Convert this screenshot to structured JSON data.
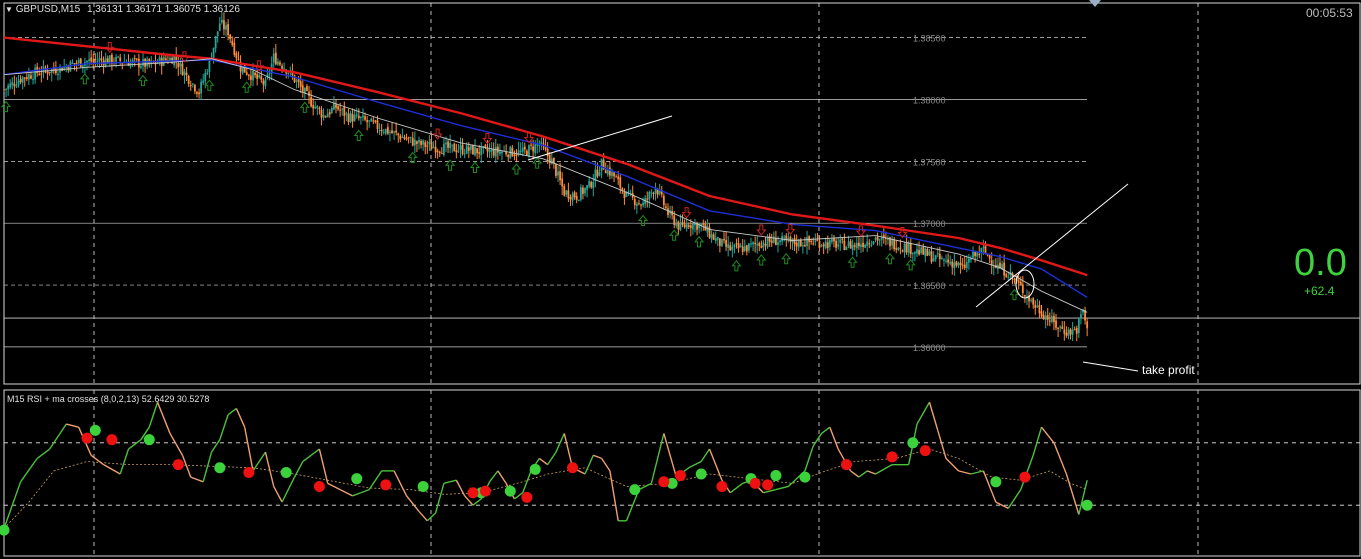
{
  "header": {
    "symbol_label": "GBPUSD,M15",
    "ohlc_text": "1.36131 1.36171 1.36075 1.36126",
    "clock": "00:05:53"
  },
  "overlay": {
    "big_value": "0.0",
    "delta_value": "+62.4",
    "take_profit_label": "take profit"
  },
  "indicator": {
    "label": "M15 RSI + ma crosses (8,0,2,13) 52.6429 30.5278"
  },
  "colors": {
    "background": "#000000",
    "grid": "#ffffff",
    "bull_candle": "#26a69a",
    "bear_candle": "#ff8c3a",
    "ma_slow": "#e01818",
    "ma_mid": "#1e2fd8",
    "ma_fast": "#c8c8c8",
    "arrow_up": "#1e8c1e",
    "arrow_down": "#d02020",
    "rsi_up": "#4cc23c",
    "rsi_down": "#f0a070",
    "cross_up": "#3cd23c",
    "cross_down": "#ee1111"
  },
  "chart_data": [
    {
      "type": "candlestick",
      "title": "GBPUSD,M15",
      "ylabel": "",
      "ylim": [
        1.357,
        1.3878
      ],
      "y_ticks": [
        "1.38500",
        "1.38000",
        "1.37500",
        "1.37000",
        "1.36500",
        "1.36000"
      ],
      "y_tick_values": [
        1.385,
        1.38,
        1.375,
        1.37,
        1.365,
        1.36
      ],
      "last_close": 1.36126,
      "take_profit_level": 1.3612,
      "close_path": [
        [
          0,
          1.3808
        ],
        [
          8,
          1.3817
        ],
        [
          16,
          1.3822
        ],
        [
          26,
          1.3825
        ],
        [
          36,
          1.383
        ],
        [
          46,
          1.3832
        ],
        [
          58,
          1.3831
        ],
        [
          70,
          1.3828
        ],
        [
          82,
          1.3834
        ],
        [
          88,
          1.3819
        ],
        [
          94,
          1.3806
        ],
        [
          99,
          1.383
        ],
        [
          104,
          1.3862
        ],
        [
          108,
          1.3855
        ],
        [
          114,
          1.3826
        ],
        [
          120,
          1.3819
        ],
        [
          126,
          1.3812
        ],
        [
          130,
          1.3834
        ],
        [
          136,
          1.3825
        ],
        [
          142,
          1.3812
        ],
        [
          148,
          1.3798
        ],
        [
          154,
          1.3787
        ],
        [
          160,
          1.3794
        ],
        [
          166,
          1.3786
        ],
        [
          172,
          1.3784
        ],
        [
          180,
          1.3778
        ],
        [
          190,
          1.3771
        ],
        [
          200,
          1.3764
        ],
        [
          210,
          1.3761
        ],
        [
          220,
          1.376
        ],
        [
          230,
          1.3758
        ],
        [
          240,
          1.3758
        ],
        [
          250,
          1.3757
        ],
        [
          258,
          1.3764
        ],
        [
          264,
          1.375
        ],
        [
          270,
          1.3725
        ],
        [
          276,
          1.3722
        ],
        [
          282,
          1.373
        ],
        [
          288,
          1.3748
        ],
        [
          294,
          1.3738
        ],
        [
          300,
          1.3722
        ],
        [
          308,
          1.3715
        ],
        [
          314,
          1.373
        ],
        [
          320,
          1.3708
        ],
        [
          326,
          1.3696
        ],
        [
          330,
          1.37
        ],
        [
          336,
          1.3698
        ],
        [
          344,
          1.3685
        ],
        [
          350,
          1.3679
        ],
        [
          358,
          1.368
        ],
        [
          364,
          1.3684
        ],
        [
          372,
          1.3686
        ],
        [
          380,
          1.3684
        ],
        [
          390,
          1.3685
        ],
        [
          400,
          1.3683
        ],
        [
          410,
          1.3682
        ],
        [
          420,
          1.3688
        ],
        [
          428,
          1.3684
        ],
        [
          436,
          1.368
        ],
        [
          444,
          1.3675
        ],
        [
          452,
          1.367
        ],
        [
          458,
          1.3668
        ],
        [
          462,
          1.3663
        ],
        [
          466,
          1.3672
        ],
        [
          472,
          1.3678
        ],
        [
          478,
          1.3666
        ],
        [
          484,
          1.366
        ],
        [
          490,
          1.3648
        ],
        [
          496,
          1.3635
        ],
        [
          502,
          1.3625
        ],
        [
          508,
          1.3616
        ],
        [
          513,
          1.3612
        ],
        [
          517,
          1.3614
        ],
        [
          520,
          1.363
        ],
        [
          522,
          1.36126
        ]
      ],
      "moving_averages": [
        {
          "name": "",
          "color": "#e01818",
          "values": [
            [
              0,
              1.385
            ],
            [
              40,
              1.3843
            ],
            [
              80,
              1.3836
            ],
            [
              100,
              1.3833
            ],
            [
              140,
              1.3822
            ],
            [
              180,
              1.3806
            ],
            [
              220,
              1.3789
            ],
            [
              260,
              1.377
            ],
            [
              300,
              1.3748
            ],
            [
              340,
              1.3722
            ],
            [
              380,
              1.3707
            ],
            [
              420,
              1.3698
            ],
            [
              460,
              1.3688
            ],
            [
              480,
              1.368
            ],
            [
              500,
              1.367
            ],
            [
              522,
              1.3658
            ]
          ]
        },
        {
          "name": "",
          "color": "#1e2fd8",
          "values": [
            [
              0,
              1.382
            ],
            [
              40,
              1.3829
            ],
            [
              80,
              1.3831
            ],
            [
              100,
              1.3832
            ],
            [
              140,
              1.3818
            ],
            [
              180,
              1.3798
            ],
            [
              220,
              1.3779
            ],
            [
              260,
              1.3763
            ],
            [
              300,
              1.3738
            ],
            [
              340,
              1.371
            ],
            [
              380,
              1.3699
            ],
            [
              420,
              1.3694
            ],
            [
              460,
              1.368
            ],
            [
              480,
              1.3673
            ],
            [
              500,
              1.3663
            ],
            [
              522,
              1.364
            ]
          ]
        },
        {
          "name": "",
          "color": "#c8c8c8",
          "values": [
            [
              0,
              1.382
            ],
            [
              40,
              1.3826
            ],
            [
              80,
              1.383
            ],
            [
              100,
              1.3833
            ],
            [
              120,
              1.3824
            ],
            [
              140,
              1.3808
            ],
            [
              180,
              1.3785
            ],
            [
              220,
              1.3765
            ],
            [
              260,
              1.3752
            ],
            [
              300,
              1.3725
            ],
            [
              340,
              1.3695
            ],
            [
              380,
              1.3686
            ],
            [
              420,
              1.369
            ],
            [
              460,
              1.3675
            ],
            [
              480,
              1.3664
            ],
            [
              500,
              1.3645
            ],
            [
              522,
              1.3628
            ]
          ]
        }
      ],
      "signal_up_arrows": [
        0,
        38,
        66,
        98,
        116,
        144,
        170,
        196,
        214,
        226,
        246,
        256,
        307,
        322,
        334,
        352,
        364,
        376,
        408,
        426,
        436,
        486
      ],
      "signal_down_arrows": [
        50,
        86,
        122,
        208,
        232,
        252,
        328,
        364,
        378,
        412,
        432
      ]
    },
    {
      "type": "line",
      "title": "M15 RSI + ma crosses (8,0,2,13) 52.6429 30.5278",
      "ylim": [
        0,
        100
      ],
      "rsi": [
        [
          0,
          15
        ],
        [
          8,
          45
        ],
        [
          16,
          60
        ],
        [
          22,
          66
        ],
        [
          30,
          82
        ],
        [
          36,
          80
        ],
        [
          42,
          62
        ],
        [
          48,
          56
        ],
        [
          56,
          50
        ],
        [
          60,
          66
        ],
        [
          66,
          72
        ],
        [
          70,
          80
        ],
        [
          74,
          96
        ],
        [
          80,
          76
        ],
        [
          86,
          62
        ],
        [
          90,
          48
        ],
        [
          96,
          45
        ],
        [
          100,
          64
        ],
        [
          104,
          72
        ],
        [
          108,
          88
        ],
        [
          112,
          92
        ],
        [
          116,
          80
        ],
        [
          120,
          52
        ],
        [
          126,
          64
        ],
        [
          130,
          42
        ],
        [
          134,
          32
        ],
        [
          140,
          48
        ],
        [
          144,
          58
        ],
        [
          148,
          62
        ],
        [
          152,
          66
        ],
        [
          156,
          44
        ],
        [
          162,
          40
        ],
        [
          168,
          36
        ],
        [
          172,
          38
        ],
        [
          176,
          40
        ],
        [
          182,
          52
        ],
        [
          188,
          52
        ],
        [
          194,
          36
        ],
        [
          200,
          26
        ],
        [
          204,
          20
        ],
        [
          208,
          25
        ],
        [
          212,
          44
        ],
        [
          218,
          46
        ],
        [
          222,
          36
        ],
        [
          226,
          30
        ],
        [
          230,
          34
        ],
        [
          234,
          45
        ],
        [
          238,
          52
        ],
        [
          242,
          44
        ],
        [
          246,
          34
        ],
        [
          250,
          38
        ],
        [
          254,
          52
        ],
        [
          258,
          60
        ],
        [
          262,
          56
        ],
        [
          266,
          64
        ],
        [
          270,
          76
        ],
        [
          274,
          54
        ],
        [
          280,
          50
        ],
        [
          284,
          62
        ],
        [
          288,
          60
        ],
        [
          292,
          52
        ],
        [
          296,
          20
        ],
        [
          300,
          20
        ],
        [
          306,
          40
        ],
        [
          312,
          44
        ],
        [
          318,
          76
        ],
        [
          324,
          48
        ],
        [
          330,
          54
        ],
        [
          336,
          58
        ],
        [
          340,
          66
        ],
        [
          346,
          46
        ],
        [
          350,
          38
        ],
        [
          356,
          44
        ],
        [
          360,
          46
        ],
        [
          366,
          38
        ],
        [
          372,
          40
        ],
        [
          378,
          42
        ],
        [
          386,
          52
        ],
        [
          390,
          68
        ],
        [
          394,
          76
        ],
        [
          398,
          80
        ],
        [
          402,
          66
        ],
        [
          408,
          52
        ],
        [
          412,
          48
        ],
        [
          416,
          52
        ],
        [
          420,
          50
        ],
        [
          428,
          56
        ],
        [
          436,
          56
        ],
        [
          440,
          82
        ],
        [
          446,
          96
        ],
        [
          450,
          78
        ],
        [
          454,
          60
        ],
        [
          460,
          52
        ],
        [
          466,
          50
        ],
        [
          472,
          52
        ],
        [
          478,
          32
        ],
        [
          484,
          28
        ],
        [
          490,
          40
        ],
        [
          496,
          62
        ],
        [
          500,
          80
        ],
        [
          506,
          70
        ],
        [
          512,
          50
        ],
        [
          518,
          24
        ],
        [
          522,
          46
        ]
      ],
      "signal": [
        [
          0,
          15
        ],
        [
          12,
          32
        ],
        [
          24,
          52
        ],
        [
          40,
          58
        ],
        [
          60,
          56
        ],
        [
          80,
          56
        ],
        [
          100,
          55
        ],
        [
          120,
          54
        ],
        [
          140,
          50
        ],
        [
          160,
          45
        ],
        [
          176,
          41
        ],
        [
          196,
          40
        ],
        [
          212,
          37
        ],
        [
          230,
          38
        ],
        [
          250,
          45
        ],
        [
          262,
          50
        ],
        [
          280,
          54
        ],
        [
          300,
          42
        ],
        [
          320,
          44
        ],
        [
          340,
          50
        ],
        [
          360,
          47
        ],
        [
          380,
          44
        ],
        [
          396,
          52
        ],
        [
          410,
          58
        ],
        [
          430,
          60
        ],
        [
          446,
          66
        ],
        [
          460,
          60
        ],
        [
          476,
          48
        ],
        [
          490,
          46
        ],
        [
          504,
          52
        ],
        [
          514,
          44
        ],
        [
          522,
          40
        ]
      ],
      "cross_up_markers": [
        [
          0,
          14
        ],
        [
          44,
          78
        ],
        [
          70,
          72
        ],
        [
          104,
          54
        ],
        [
          136,
          51
        ],
        [
          170,
          47
        ],
        [
          202,
          42
        ],
        [
          230,
          38
        ],
        [
          244,
          39
        ],
        [
          256,
          53
        ],
        [
          304,
          40
        ],
        [
          322,
          44
        ],
        [
          336,
          50
        ],
        [
          360,
          47
        ],
        [
          372,
          49
        ],
        [
          386,
          48
        ],
        [
          438,
          70
        ],
        [
          478,
          45
        ],
        [
          522,
          30
        ]
      ],
      "cross_down_markers": [
        [
          40,
          73
        ],
        [
          52,
          72
        ],
        [
          84,
          56
        ],
        [
          118,
          51
        ],
        [
          152,
          42
        ],
        [
          184,
          43
        ],
        [
          226,
          38
        ],
        [
          232,
          39
        ],
        [
          252,
          35
        ],
        [
          274,
          54
        ],
        [
          318,
          45
        ],
        [
          326,
          49
        ],
        [
          346,
          42
        ],
        [
          362,
          44
        ],
        [
          368,
          43
        ],
        [
          406,
          56
        ],
        [
          428,
          61
        ],
        [
          444,
          65
        ],
        [
          492,
          48
        ]
      ]
    }
  ]
}
